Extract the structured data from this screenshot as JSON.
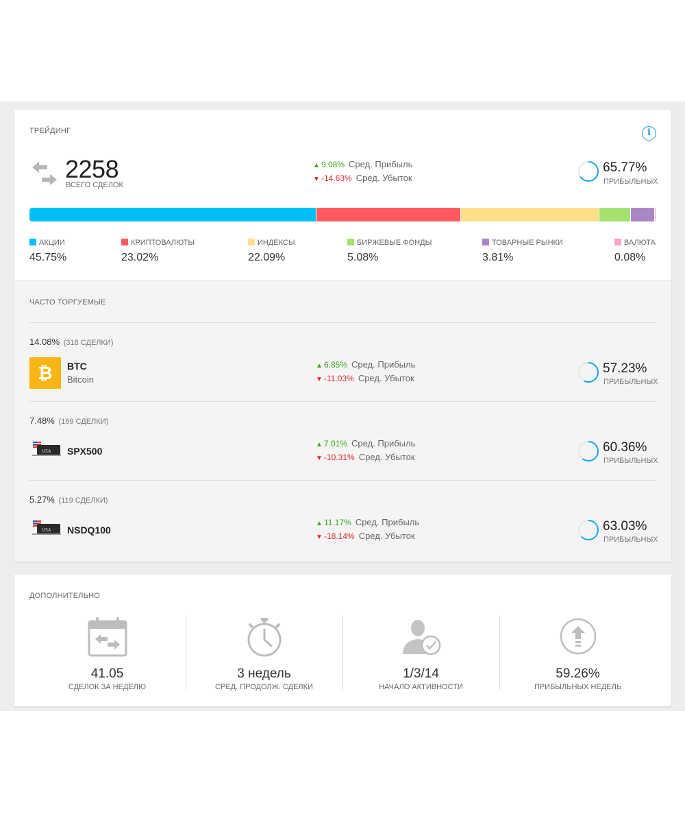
{
  "trading": {
    "title": "Трейдинг",
    "info_glyph": "i",
    "total_trades": "2258",
    "total_label": "Всего сделок",
    "avg_profit": "9.08%",
    "avg_profit_label": "Сред. Прибыль",
    "avg_loss": "-14.63%",
    "avg_loss_label": "Сред. Убыток",
    "profitable_pct": "65.77%",
    "profitable_fraction": 0.6577,
    "profitable_label": "Прибыльных"
  },
  "allocation": [
    {
      "name": "Акции",
      "value": "45.75%",
      "share": 45.75,
      "color": "#00bff5"
    },
    {
      "name": "Криптовалюты",
      "value": "23.02%",
      "share": 23.02,
      "color": "#ff5b5e"
    },
    {
      "name": "Индексы",
      "value": "22.09%",
      "share": 22.09,
      "color": "#ffdf88"
    },
    {
      "name": "Биржевые фонды",
      "value": "5.08%",
      "share": 5.08,
      "color": "#a5e170"
    },
    {
      "name": "Товарные рынки",
      "value": "3.81%",
      "share": 3.81,
      "color": "#a987c6"
    },
    {
      "name": "Валюта",
      "value": "0.08%",
      "share": 0.08,
      "color": "#fba2c6"
    }
  ],
  "frequent": {
    "title": "Часто торгуемые",
    "items": [
      {
        "share": "14.08%",
        "count": "(318 СДЕЛКИ)",
        "symbol": "BTC",
        "name": "Bitcoin",
        "logo": "bitcoin-logo",
        "avg_profit": "6.85%",
        "avg_profit_label": "Сред. Прибыль",
        "avg_loss": "-11.03%",
        "avg_loss_label": "Сред. Убыток",
        "profitable_pct": "57.23%",
        "profitable_fraction": 0.5723,
        "profitable_label": "Прибыльных"
      },
      {
        "share": "7.48%",
        "count": "(169 СДЕЛКИ)",
        "symbol": "SPX500",
        "name": "",
        "logo": "usa-index-logo",
        "logo_text": "USA",
        "avg_profit": "7.01%",
        "avg_profit_label": "Сред. Прибыль",
        "avg_loss": "-10.31%",
        "avg_loss_label": "Сред. Убыток",
        "profitable_pct": "60.36%",
        "profitable_fraction": 0.6036,
        "profitable_label": "Прибыльных"
      },
      {
        "share": "5.27%",
        "count": "(119 СДЕЛКИ)",
        "symbol": "NSDQ100",
        "name": "",
        "logo": "usa-index-logo",
        "logo_text": "USA",
        "avg_profit": "11.17%",
        "avg_profit_label": "Сред. Прибыль",
        "avg_loss": "-18.14%",
        "avg_loss_label": "Сред. Убыток",
        "profitable_pct": "63.03%",
        "profitable_fraction": 0.6303,
        "profitable_label": "Прибыльных"
      }
    ]
  },
  "extra": {
    "title": "Дополнительно",
    "stats": [
      {
        "value": "41.05",
        "label": "Сделок за неделю",
        "icon": "calendar-swap-icon"
      },
      {
        "value": "3 недель",
        "label": "Сред. продолж. сделки",
        "icon": "stopwatch-icon"
      },
      {
        "value": "1/3/14",
        "label": "Начало активности",
        "icon": "user-check-icon"
      },
      {
        "value": "59.26%",
        "label": "Прибыльных недель",
        "icon": "arrow-up-circle-icon"
      }
    ]
  },
  "colors": {
    "accent": "#1d9bd6",
    "donut": "#1aa6e0",
    "profit": "#3ba51c",
    "loss": "#e0262f"
  }
}
